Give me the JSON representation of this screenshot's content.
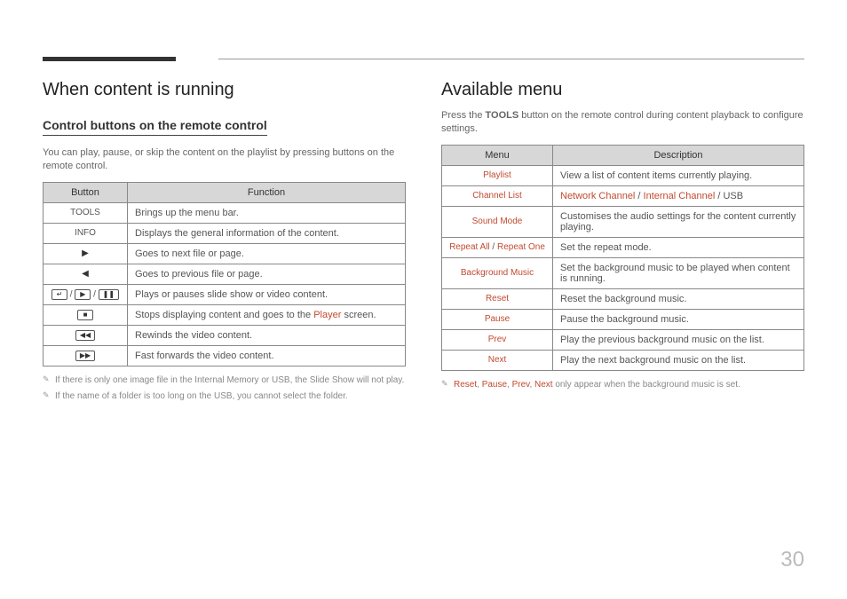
{
  "pageNumber": "30",
  "left": {
    "title": "When content is running",
    "subtitle": "Control buttons on the remote control",
    "intro": "You can play, pause, or skip the content on the playlist by pressing buttons on the remote control.",
    "headers": {
      "button": "Button",
      "function": "Function"
    },
    "rows": [
      {
        "button": "TOOLS",
        "func": "Brings up the menu bar."
      },
      {
        "button": "INFO",
        "func": "Displays the general information of the content."
      },
      {
        "button": "▶",
        "func": "Goes to next file or page."
      },
      {
        "button": "◀",
        "func": "Goes to previous file or page."
      },
      {
        "button": "↵ / ▶ / ❚❚",
        "func": "Plays or pauses slide show or video content."
      },
      {
        "button": "■",
        "func_a": "Stops displaying content and goes to the ",
        "func_accent": "Player",
        "func_b": " screen."
      },
      {
        "button": "◀◀",
        "func": "Rewinds the video content."
      },
      {
        "button": "▶▶",
        "func": "Fast forwards the video content."
      }
    ],
    "notes": [
      "If there is only one image file in the Internal Memory or USB, the Slide Show will not play.",
      "If the name of a folder is too long on the USB, you cannot select the folder."
    ]
  },
  "right": {
    "title": "Available menu",
    "intro_a": "Press the ",
    "intro_bold": "TOOLS",
    "intro_b": " button on the remote control during content playback to configure settings.",
    "headers": {
      "menu": "Menu",
      "desc": "Description"
    },
    "rows": [
      {
        "menu": "Playlist",
        "desc": "View a list of content items currently playing."
      },
      {
        "menu": "Channel List",
        "desc_parts": [
          {
            "t": "Network Channel",
            "a": true
          },
          {
            "t": " / "
          },
          {
            "t": "Internal Channel",
            "a": true
          },
          {
            "t": " / USB"
          }
        ]
      },
      {
        "menu": "Sound Mode",
        "desc": "Customises the audio settings for the content currently playing."
      },
      {
        "menu_parts": [
          {
            "t": "Repeat All",
            "a": true
          },
          {
            "t": " / "
          },
          {
            "t": "Repeat One",
            "a": true
          }
        ],
        "desc": "Set the repeat mode."
      },
      {
        "menu": "Background Music",
        "desc": "Set the background music to be played when content is running."
      },
      {
        "menu": "Reset",
        "desc": "Reset the background music."
      },
      {
        "menu": "Pause",
        "desc": "Pause the background music."
      },
      {
        "menu": "Prev",
        "desc": "Play the previous background music on the list."
      },
      {
        "menu": "Next",
        "desc": "Play the next background music on the list."
      }
    ],
    "note_parts": [
      {
        "t": "Reset",
        "a": true
      },
      {
        "t": ", "
      },
      {
        "t": "Pause",
        "a": true
      },
      {
        "t": ", "
      },
      {
        "t": "Prev",
        "a": true
      },
      {
        "t": ", "
      },
      {
        "t": "Next",
        "a": true
      },
      {
        "t": " only appear when the background music is set."
      }
    ]
  }
}
